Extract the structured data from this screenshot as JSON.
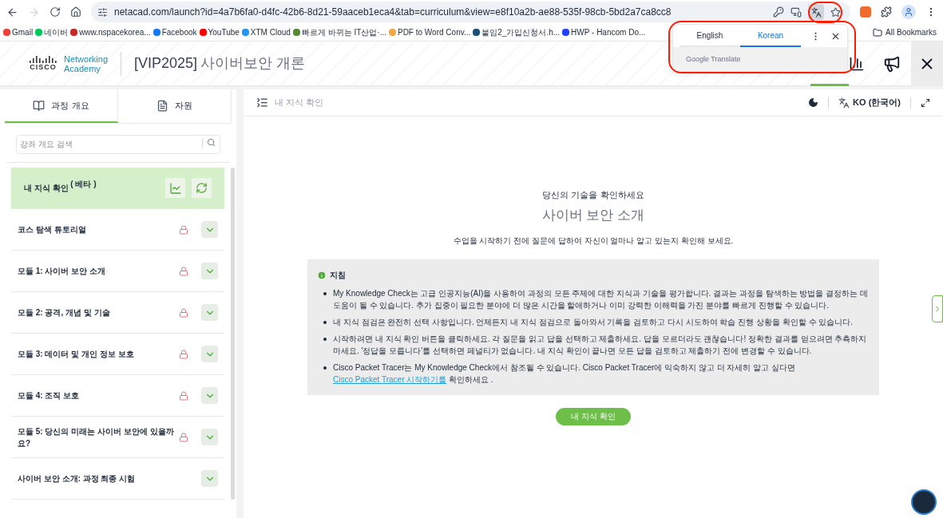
{
  "browser": {
    "url": "netacad.com/launch?id=4a7b6fa0-d4fc-42b6-8d21-59aaceb1eca4&tab=curriculum&view=e8f10a2b-ae88-535f-98cb-5bd2a7ca8cc8",
    "bookmarks": [
      {
        "label": "Gmail",
        "color": "#ea4335"
      },
      {
        "label": "네이버",
        "color": "#03c75a"
      },
      {
        "label": "www.nspacekorea...",
        "color": "#c62828"
      },
      {
        "label": "Facebook",
        "color": "#1877f2"
      },
      {
        "label": "YouTube",
        "color": "#ff0000"
      },
      {
        "label": "XTM Cloud",
        "color": "#2196f3"
      },
      {
        "label": "빠르게 바뀌는 IT산업·...",
        "color": "#558b2f"
      },
      {
        "label": "PDF to Word Conv...",
        "color": "#f4a742"
      },
      {
        "label": "붙임2_가입신청서.h...",
        "color": "#1a4f7a"
      },
      {
        "label": "HWP - Hancom Do...",
        "color": "#1e40ff"
      }
    ],
    "all_bookmarks": "All Bookmarks"
  },
  "translate_popup": {
    "tabs": [
      {
        "label": "English",
        "selected": false
      },
      {
        "label": "Korean",
        "selected": true
      }
    ],
    "brand": "Google Translate"
  },
  "header": {
    "wordmark": "CISCO",
    "logo_line1": "Networking",
    "logo_line2": "Academy",
    "course_code": "[VIP2025]",
    "course_title": "사이버보안 개론"
  },
  "sidebar": {
    "tabs": [
      {
        "label": "과정 개요",
        "selected": true
      },
      {
        "label": "자원",
        "selected": false
      }
    ],
    "search_placeholder": "강좌 개요 검색",
    "items": [
      {
        "kind": "check",
        "title": "내 지식 확인 $^{( 베타 )}$",
        "selected": true,
        "locked": false
      },
      {
        "kind": "module",
        "title": "코스 탐색 튜토리얼",
        "selected": false,
        "locked": true
      },
      {
        "kind": "module",
        "title": "모듈 1: 사이버 보안 소개",
        "selected": false,
        "locked": true
      },
      {
        "kind": "module",
        "title": "모듈 2: 공격, 개념 및 기술",
        "selected": false,
        "locked": true
      },
      {
        "kind": "module",
        "title": "모듈 3: 데이터 및 개인 정보 보호",
        "selected": false,
        "locked": true
      },
      {
        "kind": "module",
        "title": "모듈 4: 조직 보호",
        "selected": false,
        "locked": true
      },
      {
        "kind": "module",
        "title": "모듈 5: 당신의 미래는 사이버 보안에 있을까요?",
        "selected": false,
        "locked": true
      },
      {
        "kind": "module",
        "title": "사이버 보안 소개: 과정 최종 시험",
        "selected": false,
        "locked": false
      }
    ]
  },
  "main": {
    "breadcrumb": "내 지식 확인",
    "language": "KO (한국어)",
    "subtitle": "당신의 기술을 확인하세요",
    "title": "사이버 보안 소개",
    "description": "수업을 시작하기 전에 질문에 답하여 자신이 얼마나 알고 있는지 확인해 보세요.",
    "instructions": {
      "heading": "지침",
      "bullets": [
        {
          "parts": [
            {
              "kind": "text",
              "text": "My Knowledge Check는 고급 인공지능(AI)을 사용하여 과정의 모든 주제에 대한 지식과 기술을 평가합니다. 결과는 과정을 탐색하는 방법을 결정하는 데 도움이 될 수 있습니다. 추가 집중이 필요한 분야에 더 많은 시간을 할애하거나 이미 강력한 이해력을 가진 분야를 빠르게 진행할 수 있습니다."
            }
          ]
        },
        {
          "parts": [
            {
              "kind": "text",
              "text": "내 지식 점검은 완전히 선택 사항입니다. 언제든지 내 지식 점검으로 돌아와서 기록을 검토하고 다시 시도하여 학습 진행 상황을 확인할 수 있습니다."
            }
          ]
        },
        {
          "parts": [
            {
              "kind": "text",
              "text": "시작하려면 내 지식 확인 버튼을 클릭하세요. 각 질문을 읽고 답을 선택하고 제출하세요. 답을 모르더라도 괜찮습니다! 정확한 결과를 얻으려면 추측하지 마세요. '정답을 모릅니다'를 선택하면 페널티가 없습니다. 내 지식 확인이 끝나면 모든 답을 검토하고 제출하기 전에 변경할 수 있습니다."
            }
          ]
        },
        {
          "parts": [
            {
              "kind": "text",
              "text": "Cisco Packet Tracer는 My Knowledge Check에서 참조될 수 있습니다. Cisco Packet Tracer에 익숙하지 않고 더 자세히 알고 싶다면 "
            },
            {
              "kind": "link",
              "text": "Cisco Packet Tracer 시작하기를"
            },
            {
              "kind": "text",
              "text": " 확인하세요 ."
            }
          ]
        }
      ]
    },
    "start_button": "내 지식 확인"
  }
}
